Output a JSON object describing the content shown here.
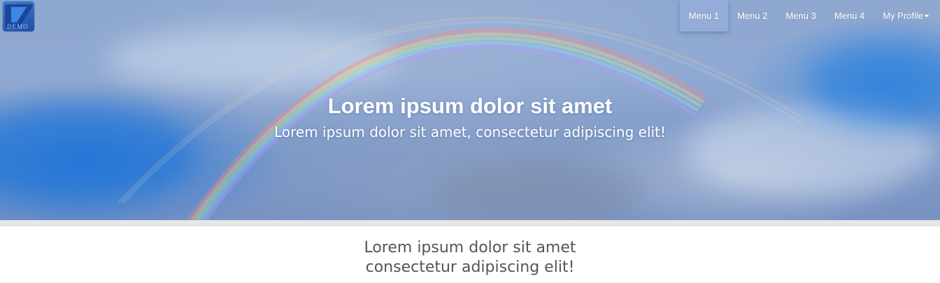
{
  "logo": {
    "text": "DEMO",
    "icon": "play-logo-icon",
    "color": "#2f6fd0"
  },
  "nav": {
    "items": [
      {
        "label": "Menu 1",
        "active": true
      },
      {
        "label": "Menu 2",
        "active": false
      },
      {
        "label": "Menu 3",
        "active": false
      },
      {
        "label": "Menu 4",
        "active": false
      }
    ],
    "profile": {
      "label": "My Profile",
      "icon": "caret-down-icon"
    }
  },
  "hero": {
    "title": "Lorem ipsum dolor sit amet",
    "subtitle": "Lorem ipsum dolor sit amet, consectetur adipiscing elit!"
  },
  "content": {
    "line1": "Lorem ipsum dolor sit amet",
    "line2": "consectetur adipiscing elit!"
  },
  "colors": {
    "sky": "#8fa8d0",
    "band": "#e6e6e6",
    "text_dark": "#555555",
    "text_light": "#ffffff"
  }
}
